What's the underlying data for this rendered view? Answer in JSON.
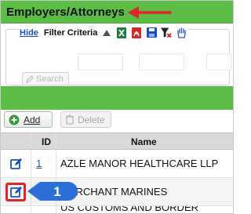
{
  "header": {
    "title": "Employers/Attorneys"
  },
  "filter": {
    "hide_label": "Hide",
    "criteria_label": "Filter Criteria",
    "search_label": "Search",
    "tools": [
      "collapse-caret-icon",
      "excel-export-icon",
      "pdf-export-icon",
      "save-icon",
      "clear-filter-icon",
      "pan-hand-icon"
    ]
  },
  "actions": {
    "add_label": "Add",
    "delete_label": "Delete"
  },
  "table": {
    "columns": {
      "edit": "",
      "id": "ID",
      "name": "Name"
    },
    "rows": [
      {
        "id": "1",
        "name": "AZLE MANOR HEALTHCARE LLP"
      },
      {
        "id": "",
        "name": "MERCHANT MARINES"
      },
      {
        "id": "",
        "name": "US CUSTOMS AND BORDER"
      }
    ]
  },
  "annotation": {
    "step_number": "1"
  },
  "colors": {
    "header_green": "#5bbd45",
    "link_blue": "#1a57c6",
    "annotation_red": "#e0242a",
    "callout_blue": "#2c6fd6"
  }
}
